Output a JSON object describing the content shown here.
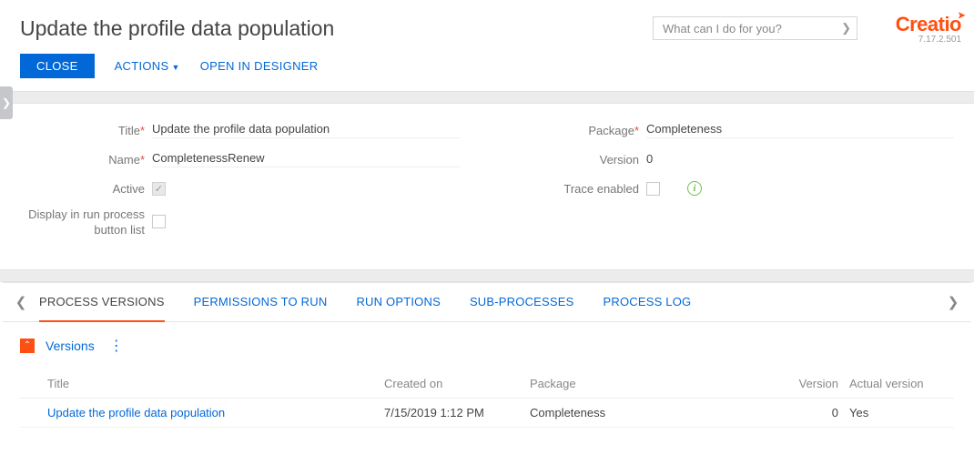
{
  "header": {
    "title": "Update the profile data population",
    "search_placeholder": "What can I do for you?",
    "brand": "Creatio",
    "version": "7.17.2.501"
  },
  "toolbar": {
    "close": "CLOSE",
    "actions": "ACTIONS",
    "open_designer": "OPEN IN DESIGNER"
  },
  "form": {
    "labels": {
      "title": "Title",
      "name": "Name",
      "active": "Active",
      "display_button": "Display in run process button list",
      "package": "Package",
      "version": "Version",
      "trace": "Trace enabled"
    },
    "values": {
      "title": "Update the profile data population",
      "name": "CompletenessRenew",
      "active": true,
      "display_button": false,
      "package": "Completeness",
      "version": "0",
      "trace": false
    }
  },
  "tabs": [
    "PROCESS VERSIONS",
    "PERMISSIONS TO RUN",
    "RUN OPTIONS",
    "SUB-PROCESSES",
    "PROCESS LOG"
  ],
  "active_tab": 0,
  "detail": {
    "title": "Versions",
    "columns": {
      "title": "Title",
      "created": "Created on",
      "package": "Package",
      "version": "Version",
      "actual": "Actual version"
    },
    "rows": [
      {
        "title": "Update the profile data population",
        "created": "7/15/2019 1:12 PM",
        "package": "Completeness",
        "version": "0",
        "actual": "Yes"
      }
    ]
  }
}
